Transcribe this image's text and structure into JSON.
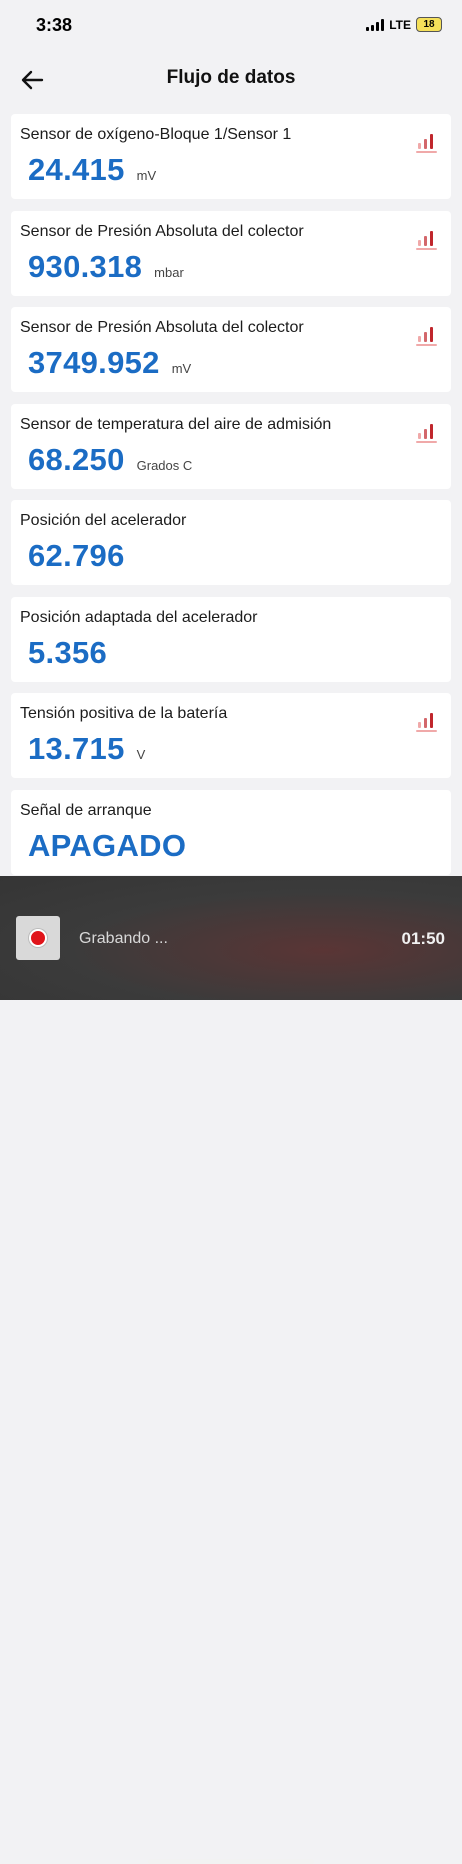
{
  "status_bar": {
    "time": "3:38",
    "network": "LTE",
    "battery": "18"
  },
  "header": {
    "title": "Flujo de datos"
  },
  "sensors": [
    {
      "label": "Sensor de oxígeno-Bloque 1/Sensor 1",
      "value": "24.415",
      "unit": "mV",
      "graph": true
    },
    {
      "label": "Sensor de Presión Absoluta del colector",
      "value": "930.318",
      "unit": "mbar",
      "graph": true
    },
    {
      "label": "Sensor de Presión Absoluta del colector",
      "value": "3749.952",
      "unit": "mV",
      "graph": true
    },
    {
      "label": "Sensor de temperatura del aire de admisión",
      "value": "68.250",
      "unit": "Grados C",
      "graph": true
    },
    {
      "label": "Posición del acelerador",
      "value": "62.796",
      "unit": "",
      "graph": false
    },
    {
      "label": "Posición adaptada del acelerador",
      "value": "5.356",
      "unit": "",
      "graph": false
    },
    {
      "label": "Tensión positiva de la batería",
      "value": "13.715",
      "unit": "V",
      "graph": true
    },
    {
      "label": "Señal de arranque",
      "value": "APAGADO",
      "unit": "",
      "graph": false
    }
  ],
  "recording": {
    "label": "Grabando ...",
    "time": "01:50"
  },
  "colors": {
    "value": "#1b6cc4",
    "graph_icon": "#c0262c",
    "record": "#e0141a"
  }
}
